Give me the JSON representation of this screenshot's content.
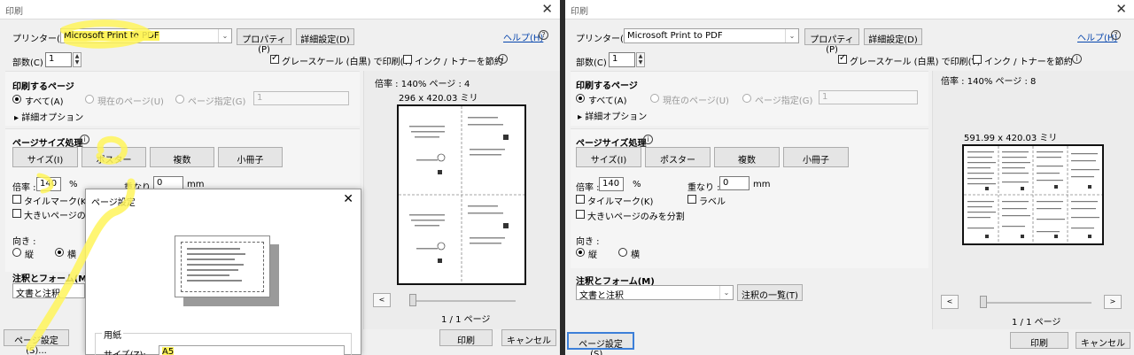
{
  "common": {
    "dialog_title": "印刷",
    "printer_label": "プリンター(N) :",
    "printer_value": "Microsoft Print to PDF",
    "properties_btn": "プロパティ(P)",
    "advanced_btn": "詳細設定(D)",
    "help_link": "ヘルプ(H)",
    "copies_label": "部数(C) :",
    "copies_value": "1",
    "grayscale_label": "グレースケール (白黒) で印刷(Y)",
    "save_ink_label": "インク / トナーを節約",
    "pages_header": "印刷するページ",
    "all_label": "すべて(A)",
    "current_label": "現在のページ(U)",
    "page_spec_label": "ページ指定(G)",
    "page_spec_value": "1",
    "more_options": "詳細オプション",
    "size_header": "ページサイズ処理",
    "size_btn": "サイズ(I)",
    "poster_btn": "ポスター",
    "multiple_btn": "複数",
    "booklet_btn": "小冊子",
    "scale_label": "倍率 :",
    "scale_value": "140",
    "percent": "%",
    "overlap_label": "重なり :",
    "overlap_value": "0",
    "mm": "mm",
    "tile_marks": "タイルマーク(K)",
    "labels": "ラベル",
    "large_only": "大きいページのみを分割",
    "orientation_label": "向き :",
    "portrait": "縦",
    "landscape": "横",
    "annot_header": "注釈とフォーム(M)",
    "annot_value": "文書と注釈",
    "annot_list_btn": "注釈の一覧(T)",
    "page_setup_btn": "ページ設定(S)...",
    "print_btn": "印刷",
    "cancel_btn": "キャンセル",
    "page_counter": "1 / 1 ページ",
    "prev": "<",
    "next": ">"
  },
  "left": {
    "zoom_info": "倍率 : 140% ページ : 4",
    "sheet_size": "296 x 420.03 ミリ",
    "large_only_truncated": "大きいページのみを",
    "popup": {
      "title": "ページ設定",
      "paper_group": "用紙",
      "size_label": "サイズ(Z):",
      "size_value": "A5"
    }
  },
  "right": {
    "zoom_info": "倍率 : 140% ページ : 8",
    "sheet_size": "591.99 x 420.03 ミリ"
  },
  "icons": [
    "info-icon",
    "close-icon",
    "chevron-down-icon",
    "spin-up-down-icon"
  ],
  "colors": {
    "highlight": "#fff45a",
    "link": "#0645ad",
    "focus": "#3c7fd8"
  }
}
